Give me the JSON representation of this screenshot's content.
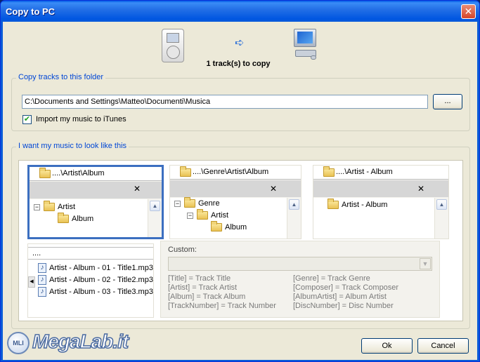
{
  "window": {
    "title": "Copy to PC",
    "close_glyph": "✕"
  },
  "summary": {
    "track_count_text": "1 track(s) to copy",
    "arrow_glyph": "➪"
  },
  "folder_group": {
    "legend": "Copy tracks to this folder",
    "path_value": "C:\\Documents and Settings\\Matteo\\Documenti\\Musica",
    "browse_label": "...",
    "import_checked": true,
    "import_label": "Import my music to iTunes",
    "check_glyph": "✔"
  },
  "look_group": {
    "legend": "I want my music to look like this",
    "styles": [
      {
        "path": "....\\Artist\\Album",
        "close_glyph": "✕",
        "selected": true,
        "tree": [
          {
            "label": "Artist",
            "expander": "−"
          },
          {
            "label": "Album"
          }
        ]
      },
      {
        "path": "....\\Genre\\Artist\\Album",
        "close_glyph": "✕",
        "selected": false,
        "tree": [
          {
            "label": "Genre",
            "expander": "−"
          },
          {
            "label": "Artist",
            "expander": "−"
          },
          {
            "label": "Album"
          }
        ]
      },
      {
        "path": "....\\Artist - Album",
        "close_glyph": "✕",
        "selected": false,
        "tree": [
          {
            "label": "Artist - Album"
          }
        ]
      }
    ],
    "flat_style": {
      "path": "....",
      "files": [
        "Artist - Album - 01 - Title1.mp3",
        "Artist - Album - 02 - Title2.mp3",
        "Artist - Album - 03 - Title3.mp3"
      ],
      "note_glyph": "♪"
    },
    "custom": {
      "label": "Custom:",
      "value": "",
      "dropdown_glyph": "▼",
      "tokens_left": [
        "[Title] = Track Title",
        "[Artist] = Track Artist",
        "[Album] = Track Album",
        "[TrackNumber] = Track Number"
      ],
      "tokens_right": [
        "[Genre] = Track Genre",
        "[Composer] = Track Composer",
        "[AlbumArtist] = Album Artist",
        "[DiscNumber] = Disc Number"
      ]
    }
  },
  "scroll_up_glyph": "▲",
  "scroll_left_glyph": "◀",
  "buttons": {
    "ok": "Ok",
    "cancel": "Cancel"
  },
  "watermark": {
    "text": "MegaLab.it",
    "logo_text": "MLI"
  },
  "colors": {
    "accent": "#3c6fc0",
    "legend_text": "#0046d5",
    "title_bar": "#0058e6"
  }
}
